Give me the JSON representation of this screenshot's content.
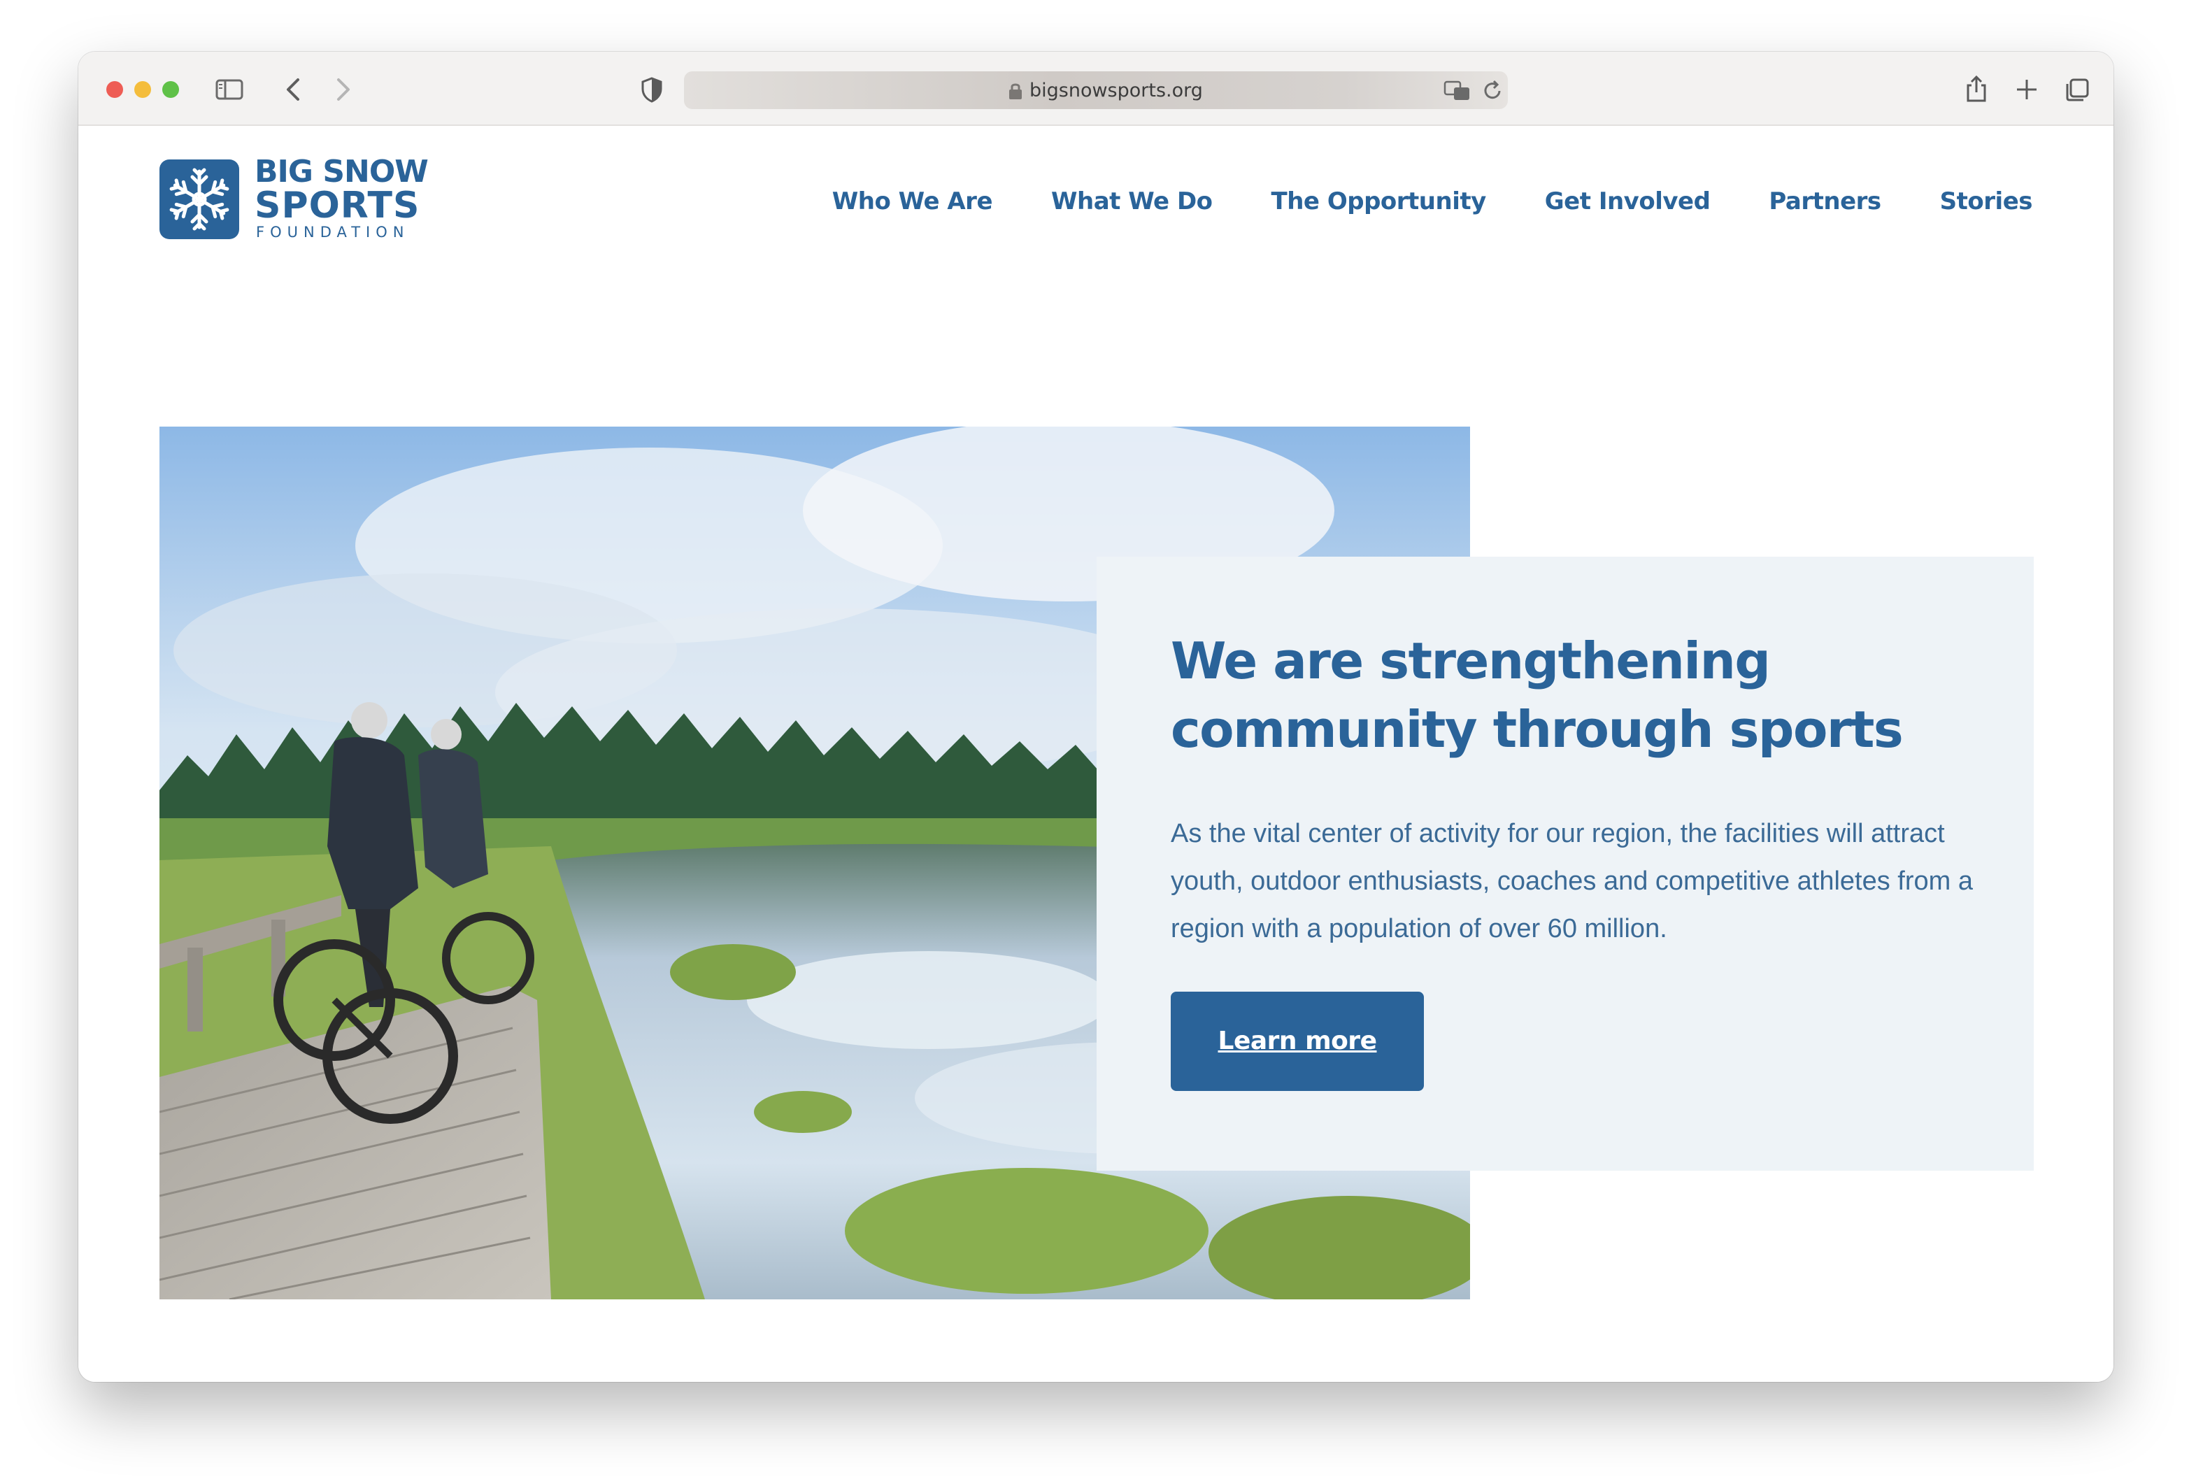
{
  "browser": {
    "url": "bigsnowsports.org"
  },
  "logo": {
    "line1": "BIG SNOW",
    "line2": "SPORTS",
    "line3": "FOUNDATION"
  },
  "nav": {
    "items": [
      {
        "label": "Who We Are"
      },
      {
        "label": "What We Do"
      },
      {
        "label": "The Opportunity"
      },
      {
        "label": "Get Involved"
      },
      {
        "label": "Partners"
      },
      {
        "label": "Stories"
      }
    ]
  },
  "hero": {
    "headline": "We are strengthening community through sports",
    "body": "As the vital center of activity for our region, the facilities will attract youth,  outdoor enthusiasts, coaches and competitive athletes from a region with a population of over 60 million.",
    "cta_label": "Learn more"
  },
  "colors": {
    "brand": "#2a6399",
    "card_bg": "#eef3f7"
  }
}
